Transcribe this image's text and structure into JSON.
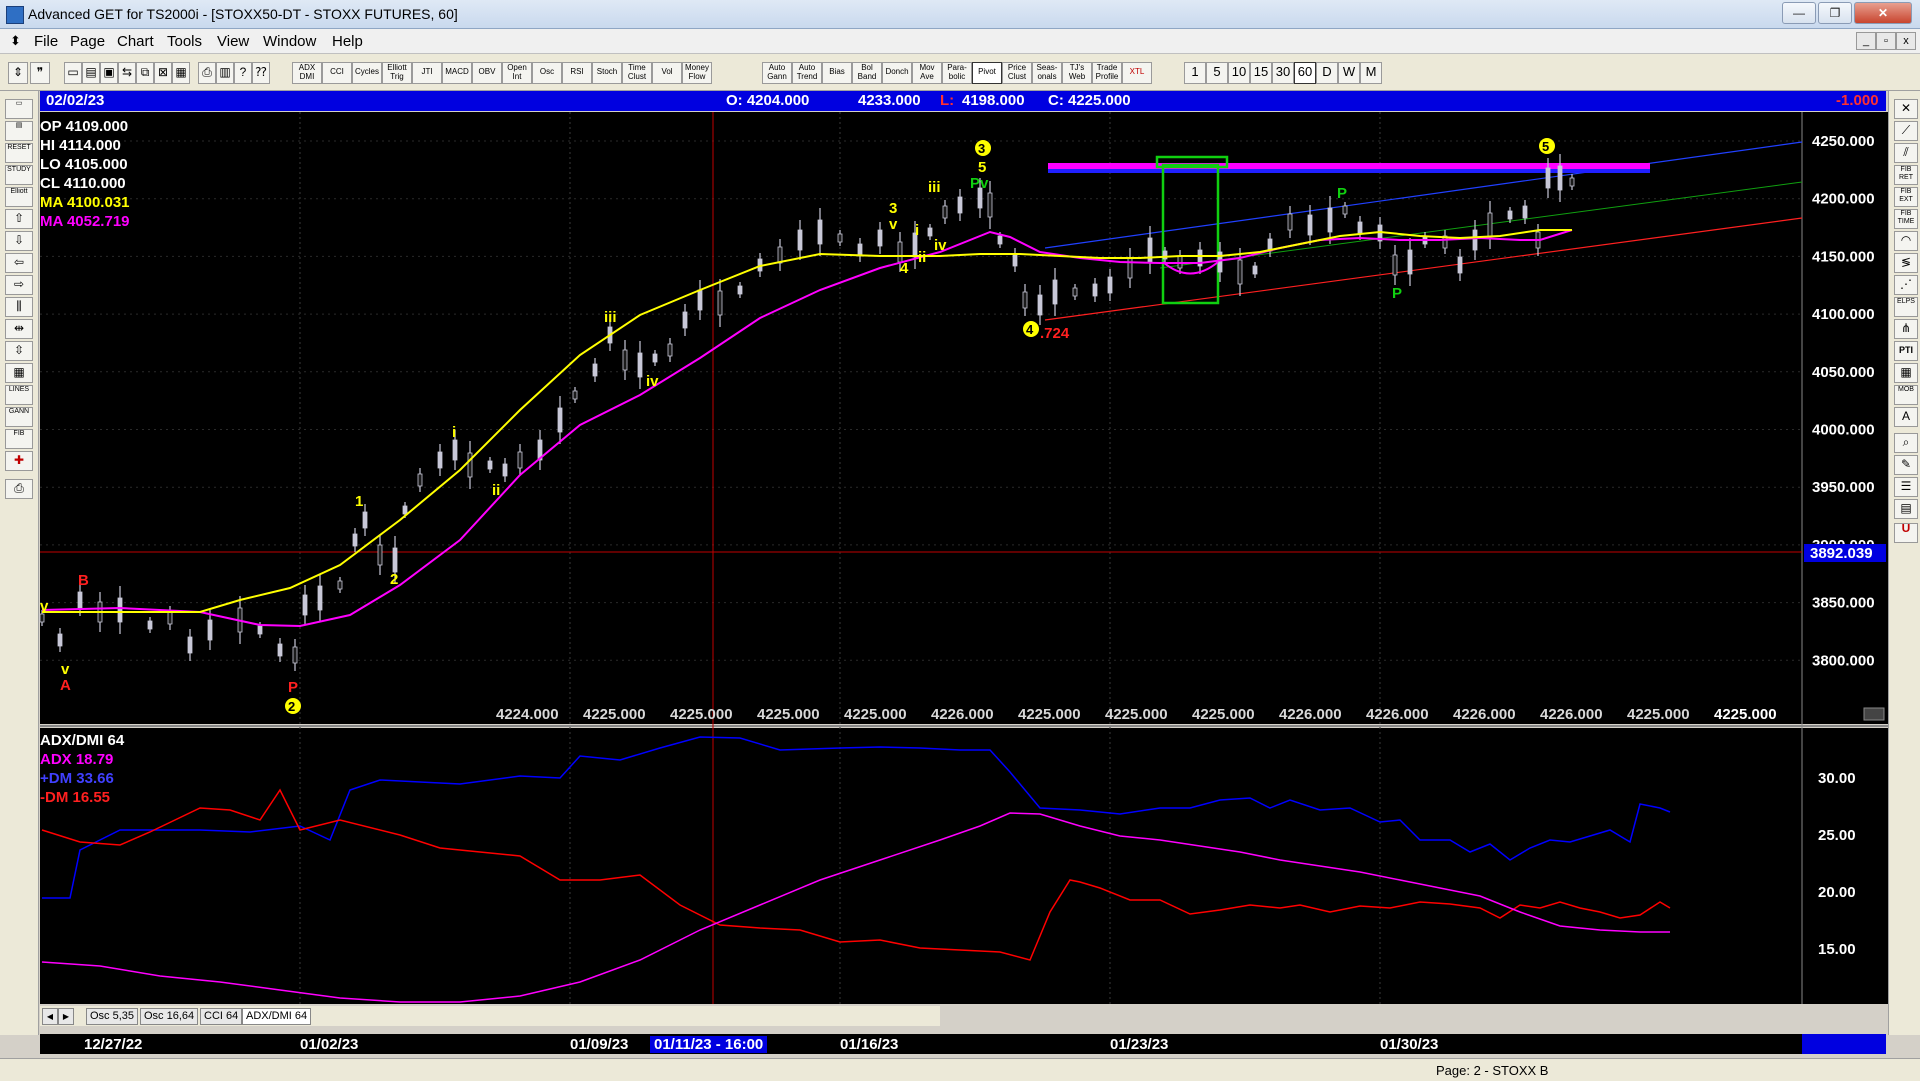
{
  "window": {
    "title": "Advanced GET for TS2000i - [STOXX50-DT - STOXX FUTURES, 60]",
    "minimize": "—",
    "restore": "❐",
    "close": "✕"
  },
  "menu": {
    "items": [
      "File",
      "Page",
      "Chart",
      "Tools",
      "View",
      "Window",
      "Help"
    ],
    "mdi": [
      "_",
      "▫",
      "x"
    ]
  },
  "toolbar": {
    "studies": [
      "ADX DMI",
      "CCI",
      "Cycles",
      "Elliott Trig",
      "JTI",
      "MACD",
      "OBV",
      "Open Int",
      "Osc",
      "RSI",
      "Stoch",
      "Time Clust",
      "Vol",
      "Money Flow",
      "Auto Gann",
      "Auto Trend",
      "Bias",
      "Bol Band",
      "Donch",
      "Mov Ave",
      "Para-bolic",
      "Pivot",
      "Price Clust",
      "Seas-onals",
      "TJ's Web",
      "Trade Profile",
      "XTL"
    ],
    "intervals": [
      "1",
      "5",
      "10",
      "15",
      "30",
      "60",
      "D",
      "W",
      "M"
    ],
    "selected_interval": "60"
  },
  "left_tools": [
    "",
    "",
    "RESET",
    "STUDY",
    "Elliott",
    "",
    "",
    "",
    "",
    "",
    "",
    "",
    "",
    "LINES",
    "GANN",
    "FIB",
    "",
    ""
  ],
  "right_tools": [
    "",
    "",
    "",
    "FIB RET",
    "FIB EXT",
    "FIB TIME",
    "",
    "",
    "",
    "ELPS",
    "",
    "PTI",
    "",
    "MOB",
    "A",
    "",
    "",
    "",
    "",
    "U"
  ],
  "header": {
    "date": "02/02/23",
    "open": "O: 4204.000",
    "high": "4233.000",
    "low_label": "L:",
    "low": "4198.000",
    "close": "C: 4225.000",
    "change": "-1.000"
  },
  "info_panel": {
    "op": "OP  4109.000",
    "hi": "HI   4114.000",
    "lo": "LO  4105.000",
    "cl": "CL   4110.000",
    "ma1": "MA  4100.031",
    "ma2": "MA  4052.719"
  },
  "price_axis": {
    "labels": [
      "4250.000",
      "4200.000",
      "4150.000",
      "4100.000",
      "4050.000",
      "4000.000",
      "3950.000",
      "3900.000",
      "3850.000",
      "3800.000"
    ],
    "cursor_price": "3892.039"
  },
  "bottom_values": [
    "4224.000",
    "4225.000",
    "4225.000",
    "4225.000",
    "4225.000",
    "4226.000",
    "4225.000",
    "4225.000",
    "4225.000",
    "4226.000",
    "4226.000",
    "4226.000",
    "4226.000",
    "4225.000",
    "4225.000"
  ],
  "wave_labels": {
    "v": "v",
    "A": "A",
    "B": "B",
    "P": "P",
    "two": "2",
    "one": "1",
    "two_b": "2",
    "i": "i",
    "ii": "ii",
    "iii": "iii",
    "iv": "iv",
    "three": "3",
    "v2": "v",
    "four": "4",
    "i2": "i",
    "ii2": "ii",
    "iii2": "iii",
    "iv2": "iv",
    "three_top": "3",
    "five": "5",
    "pv": "Pv",
    "four_circ": "4",
    "ratio": ".724",
    "p_green1": "P",
    "p_green2": "P",
    "five_circ": "5"
  },
  "indicator": {
    "title": "ADX/DMI 64",
    "adx": "ADX 18.79",
    "plus_dm": "+DM 33.66",
    "minus_dm": "-DM  16.55",
    "axis": [
      "30.00",
      "25.00",
      "20.00",
      "15.00"
    ]
  },
  "tabs": {
    "nav_left": "◀",
    "nav_right": "▶",
    "items": [
      "Osc 5,35",
      "Osc 16,64",
      "CCI 64",
      "ADX/DMI 64"
    ],
    "active": "ADX/DMI 64"
  },
  "dates": {
    "d1": "12/27/22",
    "d2": "01/02/23",
    "d3": "01/09/23",
    "d4": "01/11/23 - 16:00",
    "d5": "01/16/23",
    "d6": "01/23/23",
    "d7": "01/30/23"
  },
  "status": {
    "page": "Page: 2 - STOXX B"
  },
  "colors": {
    "price_ma_fast": "#ffff00",
    "price_ma_slow": "#ff00ff",
    "adx": "#ff00ff",
    "plus_dm": "#0000ff",
    "minus_dm": "#ff0000",
    "header_bg": "#0000e0"
  }
}
